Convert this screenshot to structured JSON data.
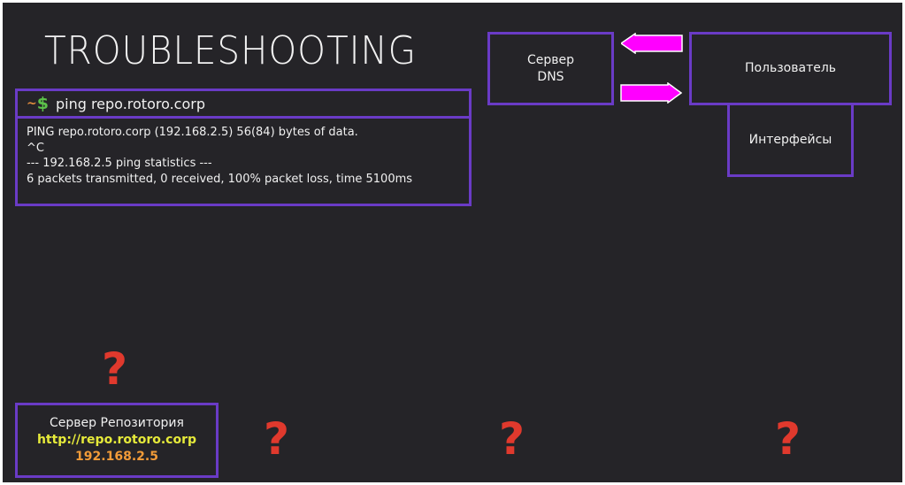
{
  "slide": {
    "title": "TROUBLESHOOTING"
  },
  "terminal": {
    "prompt_tilde": "~",
    "prompt_dollar": "$",
    "command": "ping  repo.rotoro.corp",
    "output": [
      "PING repo.rotoro.corp (192.168.2.5) 56(84) bytes of data.",
      "^C",
      "--- 192.168.2.5 ping statistics ---",
      "6 packets transmitted, 0 received, 100% packet loss, time 5100ms"
    ]
  },
  "nodes": {
    "dns_server": {
      "line1": "Сервер",
      "line2": "DNS"
    },
    "user": {
      "label": "Пользователь"
    },
    "interfaces": {
      "label": "Интерфейсы"
    },
    "repo_server": {
      "label": "Сервер Репозитория",
      "url": "http://repo.rotoro.corp",
      "ip": "192.168.2.5"
    }
  },
  "question_mark": "?",
  "colors": {
    "background": "#252428",
    "box_border": "#6a3bc6",
    "arrow_fill": "#ff00ff",
    "question_mark": "#e0392d",
    "url": "#e6ea3a",
    "ip": "#f29b38",
    "prompt_tilde": "#e08a3c",
    "prompt_dollar": "#5cc24a"
  }
}
